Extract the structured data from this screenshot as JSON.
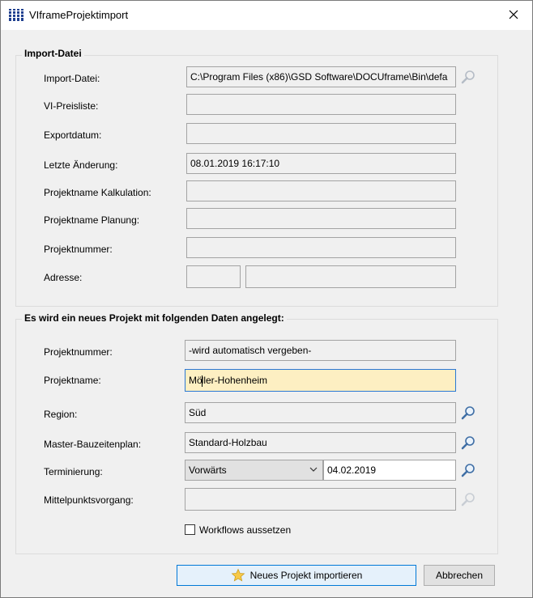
{
  "window": {
    "title": "VIframeProjektimport"
  },
  "import_group": {
    "title": "Import-Datei",
    "rows": [
      {
        "label": "Import-Datei:",
        "value": "C:\\Program Files (x86)\\GSD Software\\DOCUframe\\Bin\\defa"
      },
      {
        "label": "VI-Preisliste:",
        "value": ""
      },
      {
        "label": "Exportdatum:",
        "value": ""
      },
      {
        "label": "Letzte Änderung:",
        "value": "08.01.2019 16:17:10"
      },
      {
        "label": "Projektname Kalkulation:",
        "value": ""
      },
      {
        "label": "Projektname Planung:",
        "value": ""
      },
      {
        "label": "Projektnummer:",
        "value": ""
      },
      {
        "label": "Adresse:",
        "value_short": "",
        "value_long": ""
      }
    ]
  },
  "new_project_group": {
    "title": "Es wird ein neues Projekt mit folgenden Daten angelegt:",
    "projektnummer": {
      "label": "Projektnummer:",
      "value": "-wird automatisch vergeben-"
    },
    "projektname": {
      "label": "Projektname:",
      "value_before_cursor": "Mö",
      "value_after_cursor": "ller-Hohenheim"
    },
    "region": {
      "label": "Region:",
      "value": "Süd"
    },
    "master": {
      "label": "Master-Bauzeitenplan:",
      "value": "Standard-Holzbau"
    },
    "terminierung": {
      "label": "Terminierung:",
      "select_value": "Vorwärts",
      "date_value": "04.02.2019"
    },
    "mittelpunkt": {
      "label": "Mittelpunktsvorgang:",
      "value": ""
    },
    "workflows": {
      "label": "Workflows aussetzen",
      "checked": false
    }
  },
  "buttons": {
    "import_label": "Neues Projekt importieren",
    "cancel_label": "Abbrechen"
  },
  "colors": {
    "active_field_bg": "#fdefc2",
    "active_field_border": "#2a78d4",
    "primary_button_border": "#0078d7"
  }
}
